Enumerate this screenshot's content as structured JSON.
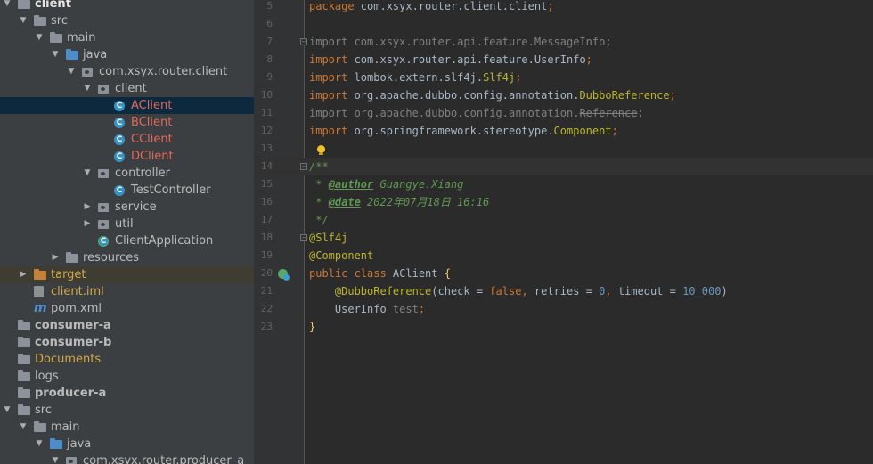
{
  "project_tree": {
    "items": [
      {
        "label": "client",
        "color": "#e6e6e6",
        "icon": "module-folder-icon"
      },
      {
        "label": "src",
        "color": "#bbbbbb",
        "icon": "folder-icon"
      },
      {
        "label": "main",
        "color": "#bbbbbb",
        "icon": "folder-icon"
      },
      {
        "label": "java",
        "color": "#bbbbbb",
        "icon": "source-folder-icon"
      },
      {
        "label": "com.xsyx.router.client",
        "color": "#bbbbbb",
        "icon": "package-icon"
      },
      {
        "label": "client",
        "color": "#bbbbbb",
        "icon": "package-icon"
      },
      {
        "label": "AClient",
        "color": "#e0695d",
        "icon": "java-class-icon",
        "selected": true
      },
      {
        "label": "BClient",
        "color": "#e0695d",
        "icon": "java-class-icon"
      },
      {
        "label": "CClient",
        "color": "#e0695d",
        "icon": "java-class-icon"
      },
      {
        "label": "DClient",
        "color": "#e0695d",
        "icon": "java-class-icon"
      },
      {
        "label": "controller",
        "color": "#bbbbbb",
        "icon": "package-icon"
      },
      {
        "label": "TestController",
        "color": "#bbbbbb",
        "icon": "java-class-icon"
      },
      {
        "label": "service",
        "color": "#bbbbbb",
        "icon": "package-icon"
      },
      {
        "label": "util",
        "color": "#bbbbbb",
        "icon": "package-icon"
      },
      {
        "label": "ClientApplication",
        "color": "#bbbbbb",
        "icon": "spring-boot-class-icon"
      },
      {
        "label": "resources",
        "color": "#bbbbbb",
        "icon": "resources-folder-icon"
      },
      {
        "label": "target",
        "color": "#cfa94a",
        "icon": "excluded-folder-icon"
      },
      {
        "label": "client.iml",
        "color": "#cfa94a",
        "icon": "iml-file-icon"
      },
      {
        "label": "pom.xml",
        "color": "#bbbbbb",
        "icon": "maven-icon"
      },
      {
        "label": "consumer-a",
        "color": "#bbbbbb",
        "icon": "module-folder-icon"
      },
      {
        "label": "consumer-b",
        "color": "#bbbbbb",
        "icon": "module-folder-icon"
      },
      {
        "label": "Documents",
        "color": "#cfa94a",
        "icon": "folder-icon"
      },
      {
        "label": "logs",
        "color": "#bbbbbb",
        "icon": "folder-icon"
      },
      {
        "label": "producer-a",
        "color": "#bbbbbb",
        "icon": "module-folder-icon"
      },
      {
        "label": "src",
        "color": "#bbbbbb",
        "icon": "folder-icon"
      },
      {
        "label": "main",
        "color": "#bbbbbb",
        "icon": "folder-icon"
      },
      {
        "label": "java",
        "color": "#bbbbbb",
        "icon": "source-folder-icon"
      },
      {
        "label": "com.xsyx.router.producer_a",
        "color": "#bbbbbb",
        "icon": "package-icon"
      }
    ]
  },
  "editor": {
    "current_line": "14",
    "lines": [
      {
        "num": "5",
        "tokens": [
          {
            "t": "package",
            "c": "k"
          },
          {
            "t": " com.xsyx.router.client.client",
            "c": ""
          },
          {
            "t": ";",
            "c": "k"
          }
        ]
      },
      {
        "num": "6",
        "tokens": []
      },
      {
        "num": "7",
        "tokens": [
          {
            "t": "import",
            "c": "mg"
          },
          {
            "t": " com.xsyx.router.api.feature.MessageInfo;",
            "c": "mg"
          }
        ]
      },
      {
        "num": "8",
        "tokens": [
          {
            "t": "import",
            "c": "k"
          },
          {
            "t": " com.xsyx.router.api.feature.UserInfo",
            "c": ""
          },
          {
            "t": ";",
            "c": "k"
          }
        ]
      },
      {
        "num": "9",
        "tokens": [
          {
            "t": "import",
            "c": "k"
          },
          {
            "t": " lombok.extern.slf4j.",
            "c": ""
          },
          {
            "t": "Slf4j",
            "c": "a"
          },
          {
            "t": ";",
            "c": "k"
          }
        ]
      },
      {
        "num": "10",
        "tokens": [
          {
            "t": "import",
            "c": "k"
          },
          {
            "t": " org.apache.dubbo.config.annotation.",
            "c": ""
          },
          {
            "t": "DubboReference",
            "c": "a"
          },
          {
            "t": ";",
            "c": "k"
          }
        ]
      },
      {
        "num": "11",
        "tokens": [
          {
            "t": "import",
            "c": "mg"
          },
          {
            "t": " org.apache.dubbo.config.annotation.",
            "c": "mg"
          },
          {
            "t": "Reference",
            "c": "mg s"
          },
          {
            "t": ";",
            "c": "mg"
          }
        ]
      },
      {
        "num": "12",
        "tokens": [
          {
            "t": "import",
            "c": "k"
          },
          {
            "t": " org.springframework.stereotype.",
            "c": ""
          },
          {
            "t": "Component",
            "c": "a"
          },
          {
            "t": ";",
            "c": "k"
          }
        ]
      },
      {
        "num": "13",
        "tokens": []
      },
      {
        "num": "14",
        "tokens": [
          {
            "t": "/**",
            "c": "c"
          }
        ]
      },
      {
        "num": "15",
        "tokens": [
          {
            "t": " * ",
            "c": "c"
          },
          {
            "t": "@author",
            "c": "ct"
          },
          {
            "t": " Guangye.Xiang",
            "c": "c"
          }
        ]
      },
      {
        "num": "16",
        "tokens": [
          {
            "t": " * ",
            "c": "c"
          },
          {
            "t": "@date",
            "c": "ct"
          },
          {
            "t": " 2022年07月18日 16:16",
            "c": "c"
          }
        ]
      },
      {
        "num": "17",
        "tokens": [
          {
            "t": " */",
            "c": "c"
          }
        ]
      },
      {
        "num": "18",
        "tokens": [
          {
            "t": "@Slf4j",
            "c": "a"
          }
        ]
      },
      {
        "num": "19",
        "tokens": [
          {
            "t": "@Component",
            "c": "a"
          }
        ]
      },
      {
        "num": "20",
        "tokens": [
          {
            "t": "public class ",
            "c": "k"
          },
          {
            "t": "AClient ",
            "c": ""
          },
          {
            "t": "{",
            "c": "y"
          }
        ]
      },
      {
        "num": "21",
        "tokens": [
          {
            "t": "    ",
            "c": ""
          },
          {
            "t": "@DubboReference",
            "c": "a"
          },
          {
            "t": "(check = ",
            "c": ""
          },
          {
            "t": "false",
            "c": "k"
          },
          {
            "t": ", ",
            "c": "k"
          },
          {
            "t": "retries = ",
            "c": ""
          },
          {
            "t": "0",
            "c": "n"
          },
          {
            "t": ", ",
            "c": "k"
          },
          {
            "t": "timeout = ",
            "c": ""
          },
          {
            "t": "10_000",
            "c": "n"
          },
          {
            "t": ")",
            "c": ""
          }
        ]
      },
      {
        "num": "22",
        "tokens": [
          {
            "t": "    UserInfo ",
            "c": ""
          },
          {
            "t": "test",
            "c": "m"
          },
          {
            "t": ";",
            "c": "k"
          }
        ]
      },
      {
        "num": "23",
        "tokens": [
          {
            "t": "}",
            "c": "y"
          }
        ]
      }
    ]
  }
}
